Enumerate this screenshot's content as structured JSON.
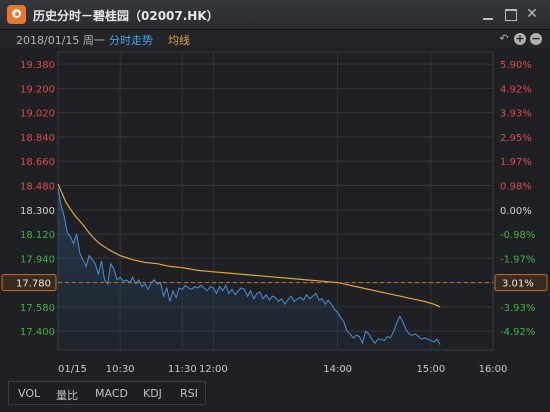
{
  "window": {
    "title": "历史分时－碧桂园（02007.HK）"
  },
  "toolbar": {
    "date": "2018/01/15 周一",
    "tab_fenshi": "分时走势",
    "tab_junxian": "均线"
  },
  "indicators": [
    "VOL",
    "量比",
    "MACD",
    "KDJ",
    "RSI"
  ],
  "colors": {
    "price": "#4a90d9",
    "avg": "#e8a431",
    "up": "#e04848",
    "down": "#3fb24a",
    "neutral": "#d0d0d0"
  },
  "chart_data": {
    "type": "line",
    "y_ticks": [
      "19.380",
      "19.200",
      "19.020",
      "18.840",
      "18.660",
      "18.480",
      "18.300",
      "18.120",
      "17.940",
      "17.780",
      "17.580",
      "17.400"
    ],
    "y_tick_values": [
      19.38,
      19.2,
      19.02,
      18.84,
      18.66,
      18.48,
      18.3,
      18.12,
      17.94,
      17.76,
      17.58,
      17.4
    ],
    "pct_ticks": [
      "5.90%",
      "4.92%",
      "3.93%",
      "2.95%",
      "1.97%",
      "0.98%",
      "0.00%",
      "-0.98%",
      "-1.97%",
      "3.01%",
      "-3.93%",
      "-4.92%"
    ],
    "x_ticks": [
      "01/15",
      "10:30",
      "11:30",
      "12:00",
      "14:00",
      "15:00",
      "16:00"
    ],
    "x_tick_minutes": [
      0,
      60,
      120,
      150,
      270,
      360,
      420
    ],
    "ylim": [
      17.26,
      19.47
    ],
    "prev_close": 18.3,
    "current_price_label": "17.780",
    "current_pct_label": "3.01%",
    "current_price": 17.76,
    "price": [
      [
        0,
        18.46
      ],
      [
        3,
        18.33
      ],
      [
        6,
        18.25
      ],
      [
        9,
        18.13
      ],
      [
        12,
        18.1
      ],
      [
        15,
        18.05
      ],
      [
        18,
        18.12
      ],
      [
        21,
        17.98
      ],
      [
        24,
        17.93
      ],
      [
        27,
        17.88
      ],
      [
        30,
        17.96
      ],
      [
        33,
        17.93
      ],
      [
        36,
        17.9
      ],
      [
        39,
        17.82
      ],
      [
        42,
        17.92
      ],
      [
        45,
        17.78
      ],
      [
        48,
        17.75
      ],
      [
        51,
        17.9
      ],
      [
        54,
        17.86
      ],
      [
        57,
        17.78
      ],
      [
        60,
        17.8
      ],
      [
        63,
        17.77
      ],
      [
        66,
        17.78
      ],
      [
        69,
        17.76
      ],
      [
        72,
        17.8
      ],
      [
        75,
        17.75
      ],
      [
        78,
        17.78
      ],
      [
        81,
        17.73
      ],
      [
        84,
        17.75
      ],
      [
        87,
        17.71
      ],
      [
        90,
        17.76
      ],
      [
        93,
        17.78
      ],
      [
        96,
        17.75
      ],
      [
        99,
        17.76
      ],
      [
        102,
        17.66
      ],
      [
        105,
        17.72
      ],
      [
        108,
        17.62
      ],
      [
        111,
        17.7
      ],
      [
        114,
        17.65
      ],
      [
        117,
        17.72
      ],
      [
        120,
        17.71
      ],
      [
        123,
        17.74
      ],
      [
        126,
        17.72
      ],
      [
        129,
        17.71
      ],
      [
        132,
        17.73
      ],
      [
        135,
        17.72
      ],
      [
        138,
        17.74
      ],
      [
        141,
        17.72
      ],
      [
        144,
        17.7
      ],
      [
        147,
        17.73
      ],
      [
        150,
        17.72
      ],
      [
        153,
        17.68
      ],
      [
        156,
        17.73
      ],
      [
        159,
        17.7
      ],
      [
        162,
        17.74
      ],
      [
        165,
        17.68
      ],
      [
        168,
        17.71
      ],
      [
        171,
        17.67
      ],
      [
        174,
        17.7
      ],
      [
        177,
        17.72
      ],
      [
        180,
        17.71
      ],
      [
        183,
        17.66
      ],
      [
        186,
        17.7
      ],
      [
        189,
        17.64
      ],
      [
        192,
        17.68
      ],
      [
        195,
        17.69
      ],
      [
        198,
        17.64
      ],
      [
        201,
        17.67
      ],
      [
        204,
        17.63
      ],
      [
        207,
        17.66
      ],
      [
        210,
        17.65
      ],
      [
        213,
        17.62
      ],
      [
        216,
        17.64
      ],
      [
        219,
        17.6
      ],
      [
        222,
        17.63
      ],
      [
        225,
        17.66
      ],
      [
        228,
        17.62
      ],
      [
        231,
        17.64
      ],
      [
        234,
        17.65
      ],
      [
        237,
        17.63
      ],
      [
        240,
        17.67
      ],
      [
        243,
        17.64
      ],
      [
        246,
        17.66
      ],
      [
        249,
        17.68
      ],
      [
        252,
        17.63
      ],
      [
        255,
        17.64
      ],
      [
        258,
        17.6
      ],
      [
        261,
        17.63
      ],
      [
        264,
        17.6
      ],
      [
        267,
        17.56
      ],
      [
        270,
        17.54
      ],
      [
        273,
        17.5
      ],
      [
        276,
        17.47
      ],
      [
        279,
        17.4
      ],
      [
        282,
        17.38
      ],
      [
        285,
        17.35
      ],
      [
        288,
        17.37
      ],
      [
        291,
        17.36
      ],
      [
        294,
        17.31
      ],
      [
        297,
        17.4
      ],
      [
        300,
        17.38
      ],
      [
        303,
        17.34
      ],
      [
        306,
        17.31
      ],
      [
        309,
        17.34
      ],
      [
        312,
        17.34
      ],
      [
        315,
        17.33
      ],
      [
        318,
        17.36
      ],
      [
        321,
        17.35
      ],
      [
        324,
        17.4
      ],
      [
        327,
        17.46
      ],
      [
        330,
        17.51
      ],
      [
        333,
        17.47
      ],
      [
        336,
        17.41
      ],
      [
        339,
        17.38
      ],
      [
        342,
        17.37
      ],
      [
        345,
        17.38
      ],
      [
        348,
        17.36
      ],
      [
        351,
        17.34
      ],
      [
        354,
        17.35
      ],
      [
        357,
        17.34
      ],
      [
        360,
        17.33
      ],
      [
        363,
        17.32
      ],
      [
        366,
        17.34
      ],
      [
        369,
        17.3
      ]
    ],
    "avg": [
      [
        0,
        18.49
      ],
      [
        8,
        18.35
      ],
      [
        16,
        18.26
      ],
      [
        24,
        18.19
      ],
      [
        32,
        18.11
      ],
      [
        40,
        18.05
      ],
      [
        50,
        18.0
      ],
      [
        60,
        17.96
      ],
      [
        72,
        17.93
      ],
      [
        84,
        17.91
      ],
      [
        96,
        17.9
      ],
      [
        108,
        17.88
      ],
      [
        120,
        17.87
      ],
      [
        135,
        17.85
      ],
      [
        150,
        17.84
      ],
      [
        165,
        17.83
      ],
      [
        180,
        17.82
      ],
      [
        195,
        17.81
      ],
      [
        210,
        17.8
      ],
      [
        225,
        17.79
      ],
      [
        240,
        17.78
      ],
      [
        255,
        17.77
      ],
      [
        270,
        17.76
      ],
      [
        282,
        17.74
      ],
      [
        294,
        17.72
      ],
      [
        306,
        17.7
      ],
      [
        318,
        17.68
      ],
      [
        330,
        17.66
      ],
      [
        342,
        17.64
      ],
      [
        354,
        17.62
      ],
      [
        363,
        17.6
      ],
      [
        369,
        17.58
      ]
    ]
  }
}
